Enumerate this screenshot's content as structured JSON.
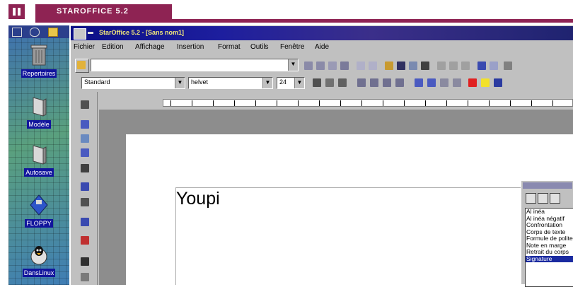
{
  "header": {
    "section_title": "STAROFFICE 5.2"
  },
  "desktop": {
    "icons": [
      {
        "label": "Repertoires",
        "icon": "trash-can-icon"
      },
      {
        "label": "Modèle",
        "icon": "folder-icon"
      },
      {
        "label": "Autosave",
        "icon": "folder-icon"
      },
      {
        "label": "FLOPPY",
        "icon": "floppy-disk-icon"
      },
      {
        "label": "DansLinux",
        "icon": "penguin-icon"
      }
    ]
  },
  "window": {
    "title": "StarOffice 5.2 - [Sans nom1]",
    "menu": [
      "Fichier",
      "Edition",
      "Affichage",
      "Insertion",
      "Format",
      "Outils",
      "Fenêtre",
      "Aide"
    ],
    "url_value": "",
    "paragraph_style": "Standard",
    "font_name": "helvet",
    "font_size": "24",
    "document_text": "Youpi"
  },
  "stylist": {
    "styles": [
      "Al inéa",
      "Al inéa négatif",
      "Confrontation",
      "Corps de texte",
      "Formule de politesse",
      "Note en marge",
      "Retrait du corps",
      "Signature"
    ],
    "selected_index": 7
  },
  "colors": {
    "accent": "#8e2353",
    "title_bar": "#0b0f86",
    "desktop_label_bg": "#11149c"
  }
}
